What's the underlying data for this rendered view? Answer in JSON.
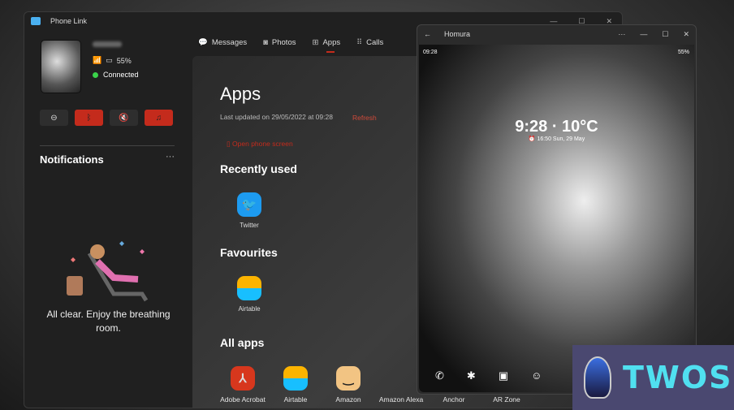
{
  "window": {
    "title": "Phone Link"
  },
  "device": {
    "battery": "55%",
    "status": "Connected"
  },
  "notifications": {
    "title": "Notifications",
    "more": "···",
    "empty_line1": "All clear. Enjoy the breathing",
    "empty_line2": "room."
  },
  "tabs": [
    {
      "label": "Messages",
      "icon": "💬"
    },
    {
      "label": "Photos",
      "icon": "◙"
    },
    {
      "label": "Apps",
      "icon": "⊞"
    },
    {
      "label": "Calls",
      "icon": "⠿"
    }
  ],
  "apps": {
    "title": "Apps",
    "last_updated": "Last updated on 29/05/2022 at 09:28",
    "refresh": "Refresh",
    "open_phone": "Open phone screen",
    "recent_title": "Recently used",
    "recent": [
      {
        "name": "Twitter"
      }
    ],
    "fav_title": "Favourites",
    "favourites": [
      {
        "name": "Airtable"
      }
    ],
    "all_title": "All apps",
    "all": [
      {
        "name": "Adobe Acrobat"
      },
      {
        "name": "Airtable"
      },
      {
        "name": "Amazon"
      },
      {
        "name": "Amazon Alexa"
      },
      {
        "name": "Anchor"
      },
      {
        "name": "AR Zone"
      }
    ]
  },
  "phone": {
    "title": "Homura",
    "status_time": "09:28",
    "status_battery": "55%",
    "clock": "9:28 · 10°C",
    "alarm": "⏰ 16:50 Sun, 29 May"
  },
  "watermark": {
    "text": "TWOS"
  },
  "colors": {
    "accent": "#c42b1c",
    "connected": "#3ad24a",
    "twitter": "#1d9bf0"
  }
}
